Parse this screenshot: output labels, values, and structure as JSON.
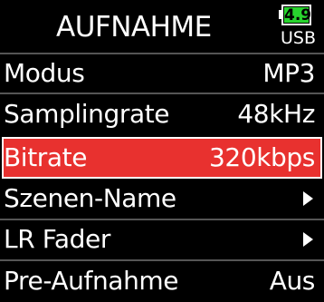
{
  "header": {
    "title": "AUFNAHME",
    "battery_level": "4.9",
    "power_source": "USB",
    "battery_color": "#28d42e",
    "battery_icon": "battery-icon"
  },
  "menu": {
    "selected_color": "#e8312f",
    "items": [
      {
        "label": "Modus",
        "value": "MP3",
        "selected": false
      },
      {
        "label": "Samplingrate",
        "value": "48kHz",
        "selected": false
      },
      {
        "label": "Bitrate",
        "value": "320kbps",
        "selected": true
      },
      {
        "label": "Szenen-Name",
        "value": "",
        "icon": "arrow-right-icon",
        "selected": false
      },
      {
        "label": "LR Fader",
        "value": "",
        "icon": "arrow-right-icon",
        "selected": false
      },
      {
        "label": "Pre-Aufnahme",
        "value": "Aus",
        "selected": false
      }
    ]
  }
}
